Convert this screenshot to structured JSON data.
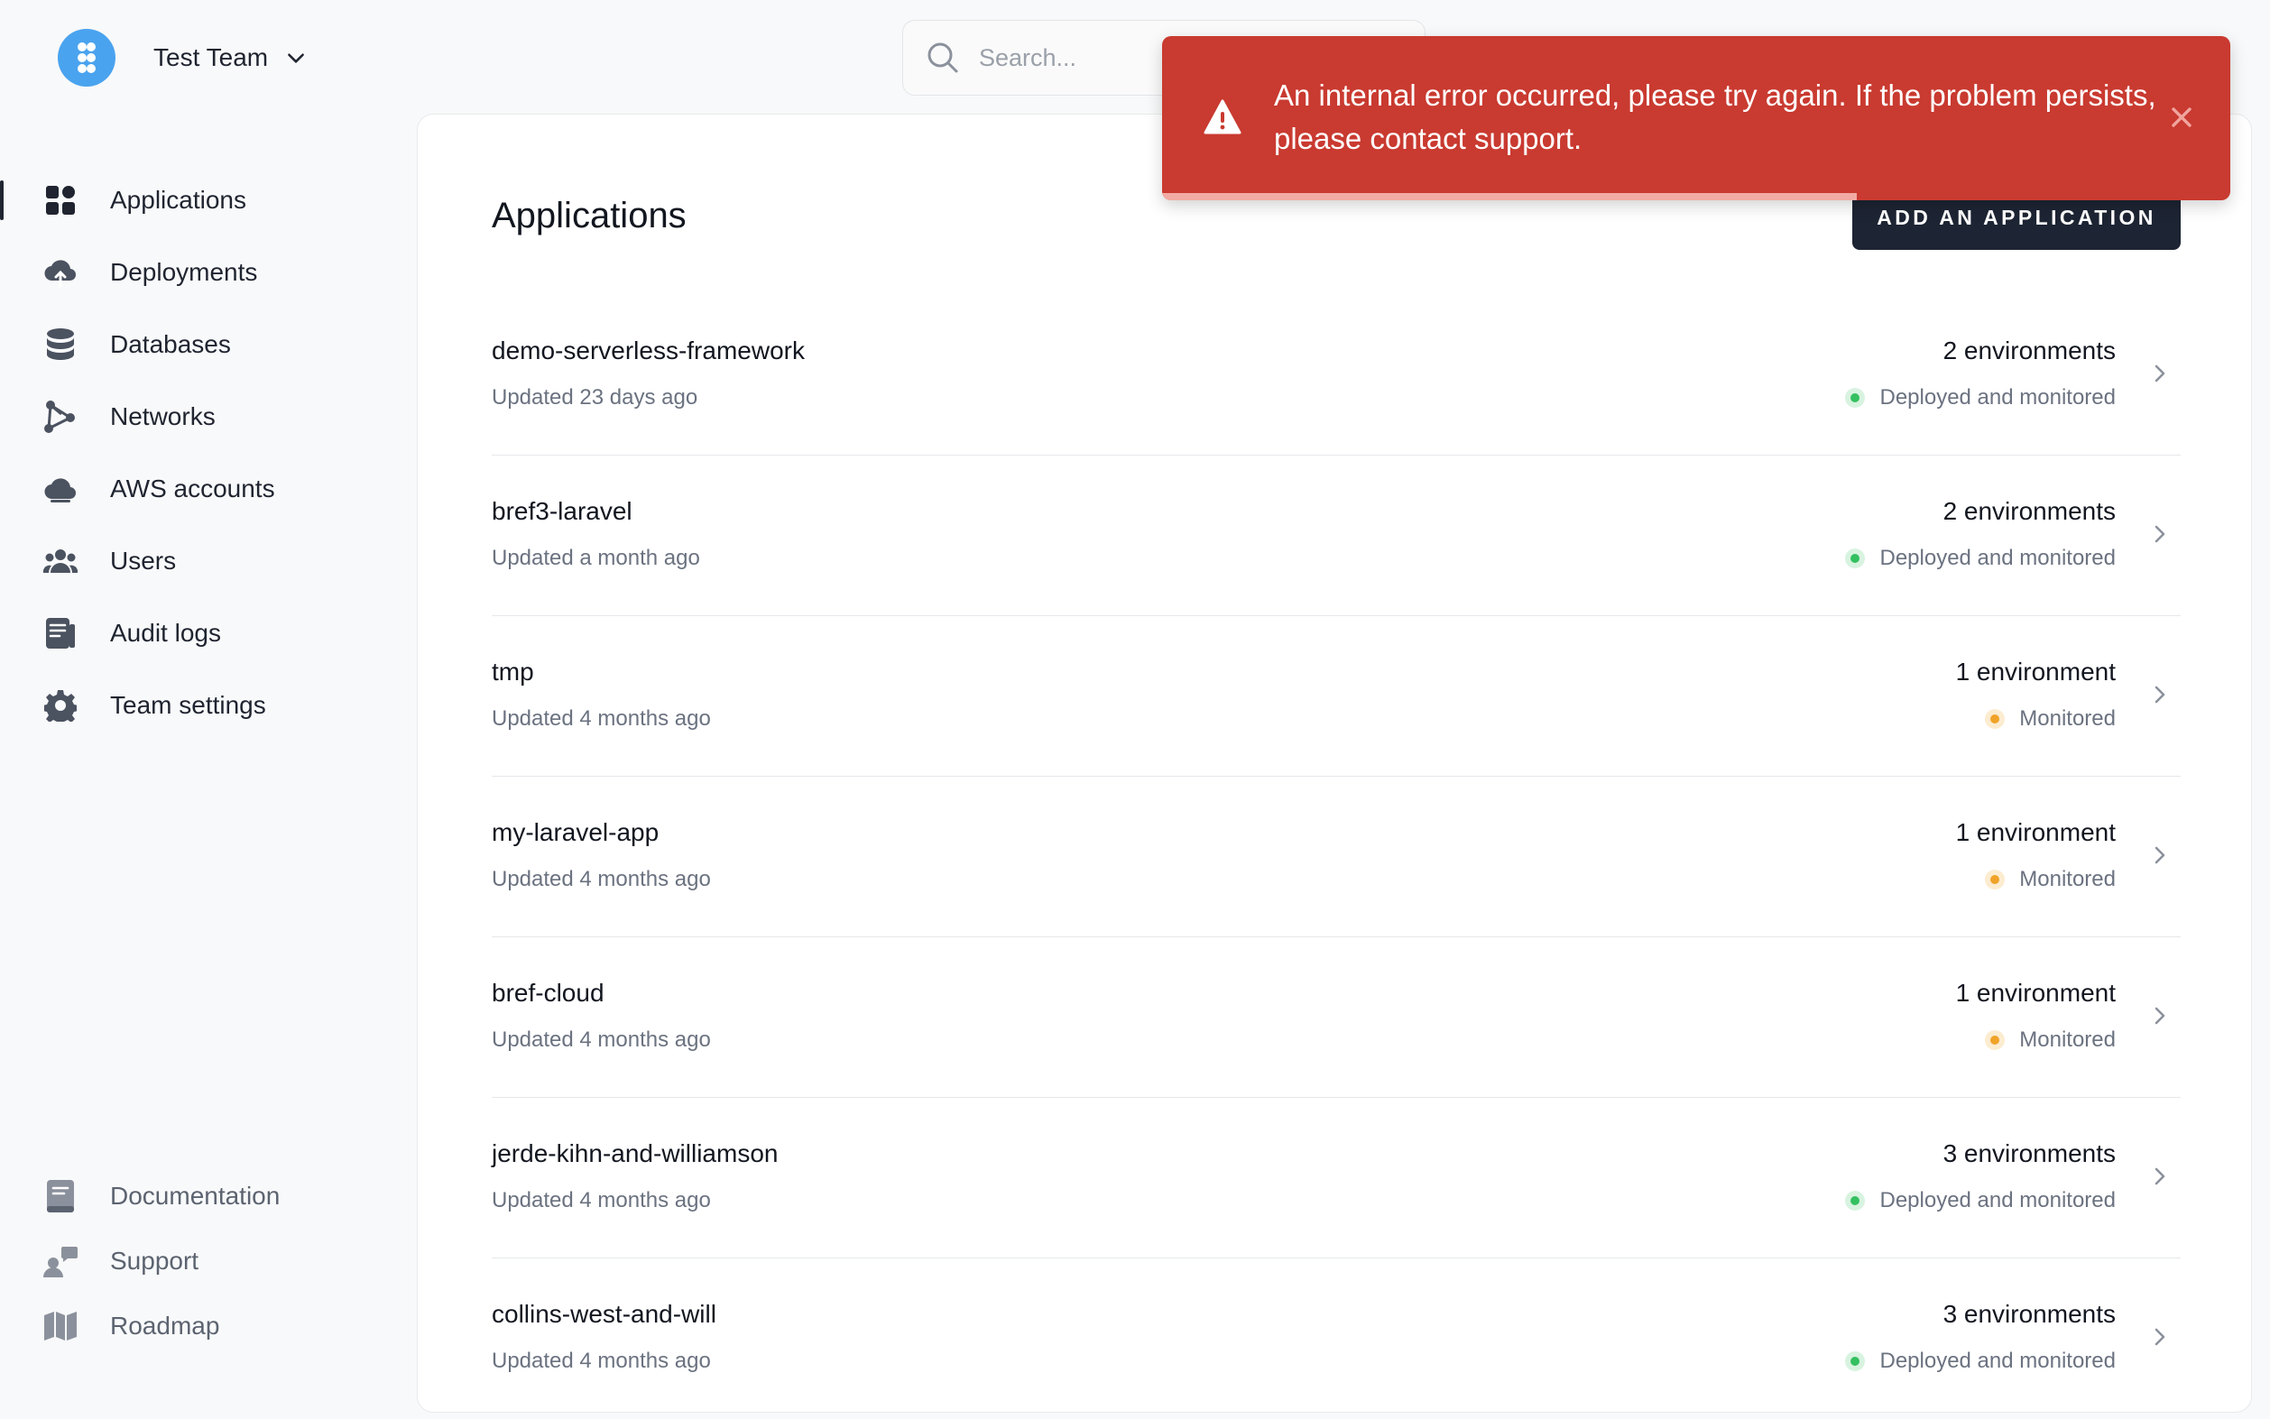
{
  "team": {
    "name": "Test Team"
  },
  "search": {
    "placeholder": "Search..."
  },
  "sidebar": {
    "items": [
      {
        "label": "Applications",
        "icon": "applications-icon",
        "active": true
      },
      {
        "label": "Deployments",
        "icon": "cloud-upload-icon"
      },
      {
        "label": "Databases",
        "icon": "database-icon"
      },
      {
        "label": "Networks",
        "icon": "network-icon"
      },
      {
        "label": "AWS accounts",
        "icon": "cloud-icon"
      },
      {
        "label": "Users",
        "icon": "users-icon"
      },
      {
        "label": "Audit logs",
        "icon": "audit-log-icon"
      },
      {
        "label": "Team settings",
        "icon": "gear-icon"
      }
    ],
    "bottom": [
      {
        "label": "Documentation",
        "icon": "book-icon"
      },
      {
        "label": "Support",
        "icon": "support-icon"
      },
      {
        "label": "Roadmap",
        "icon": "map-icon"
      }
    ]
  },
  "main": {
    "title": "Applications",
    "add_button": "ADD AN APPLICATION",
    "applications": [
      {
        "name": "demo-serverless-framework",
        "updated": "Updated 23 days ago",
        "environments": "2 environments",
        "status": "Deployed and monitored",
        "status_color": "#34c060"
      },
      {
        "name": "bref3-laravel",
        "updated": "Updated a month ago",
        "environments": "2 environments",
        "status": "Deployed and monitored",
        "status_color": "#34c060"
      },
      {
        "name": "tmp",
        "updated": "Updated 4 months ago",
        "environments": "1 environment",
        "status": "Monitored",
        "status_color": "#f0a328"
      },
      {
        "name": "my-laravel-app",
        "updated": "Updated 4 months ago",
        "environments": "1 environment",
        "status": "Monitored",
        "status_color": "#f0a328"
      },
      {
        "name": "bref-cloud",
        "updated": "Updated 4 months ago",
        "environments": "1 environment",
        "status": "Monitored",
        "status_color": "#f0a328"
      },
      {
        "name": "jerde-kihn-and-williamson",
        "updated": "Updated 4 months ago",
        "environments": "3 environments",
        "status": "Deployed and monitored",
        "status_color": "#34c060"
      },
      {
        "name": "collins-west-and-will",
        "updated": "Updated 4 months ago",
        "environments": "3 environments",
        "status": "Deployed and monitored",
        "status_color": "#34c060"
      }
    ]
  },
  "toast": {
    "message": "An internal error occurred, please try again. If the problem persists, please contact support.",
    "color": "#c93a30",
    "progress_fraction": 0.65
  }
}
